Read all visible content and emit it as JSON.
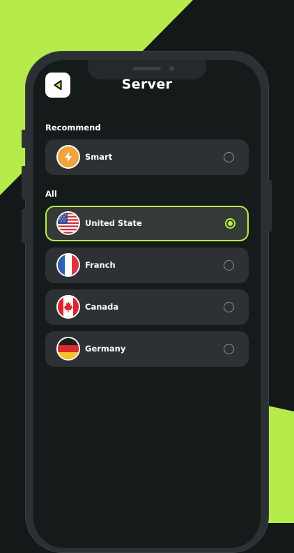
{
  "header": {
    "title": "Server"
  },
  "sections": {
    "recommend_label": "Recommend",
    "all_label": "All"
  },
  "recommend": [
    {
      "label": "Smart",
      "icon": "lightning-icon",
      "selected": false
    }
  ],
  "servers": [
    {
      "label": "United State",
      "icon": "us-flag-icon",
      "selected": true
    },
    {
      "label": "Franch",
      "icon": "france-flag-icon",
      "selected": false
    },
    {
      "label": "Canada",
      "icon": "canada-flag-icon",
      "selected": false
    },
    {
      "label": "Germany",
      "icon": "germany-flag-icon",
      "selected": false
    }
  ],
  "colors": {
    "accent": "#b8ee47",
    "background": "#141819",
    "card": "#2d3133",
    "smart_icon": "#f0a33e"
  }
}
